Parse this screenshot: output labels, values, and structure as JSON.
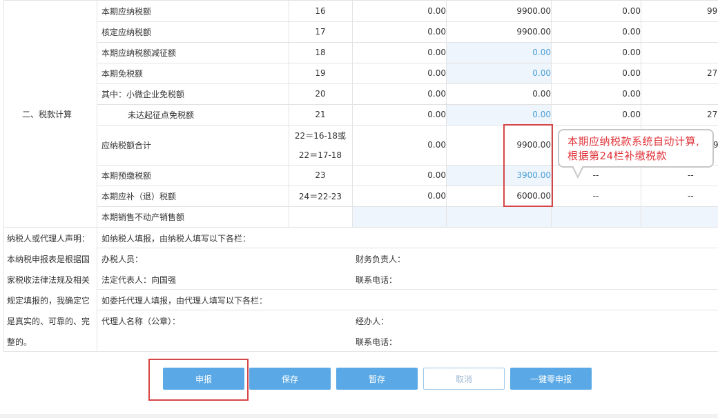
{
  "section_label": "二、税款计算",
  "rows": [
    {
      "name": "本期应纳税额",
      "line": "16",
      "c1": "0.00",
      "c2": "9900.00",
      "c3": "0.00",
      "c4": "99"
    },
    {
      "name": "核定应纳税额",
      "line": "17",
      "c1": "0.00",
      "c2": "9900.00",
      "c3": "0.00",
      "c4": ""
    },
    {
      "name": "本期应纳税额减征额",
      "line": "18",
      "c1": "0.00",
      "c2": "0.00",
      "c3": "0.00",
      "c4": ""
    },
    {
      "name": "本期免税额",
      "line": "19",
      "c1": "0.00",
      "c2": "0.00",
      "c3": "0.00",
      "c4": "27"
    },
    {
      "name": "其中：小微企业免税额",
      "line": "20",
      "c1": "0.00",
      "c2": "0.00",
      "c3": "0.00",
      "c4": ""
    },
    {
      "name": "未达起征点免税额",
      "line": "21",
      "c1": "0.00",
      "c2": "0.00",
      "c3": "0.00",
      "c4": "27"
    },
    {
      "name": "应纳税额合计",
      "line": "22＝16-18或",
      "line2": "22＝17-18",
      "c1": "0.00",
      "c2": "9900.00",
      "c3": "",
      "c4": "9"
    },
    {
      "name": "本期预缴税额",
      "line": "23",
      "c1": "0.00",
      "c2": "3900.00",
      "c3": "--",
      "c4": "--"
    },
    {
      "name": "本期应补（退）税额",
      "line": "24＝22-23",
      "c1": "0.00",
      "c2": "6000.00",
      "c3": "--",
      "c4": "--"
    },
    {
      "name": "本期销售不动产销售额",
      "line": "",
      "c1": "",
      "c2": "",
      "c3": "",
      "c4": ""
    }
  ],
  "declaration": {
    "lines": [
      "纳税人或代理人声明：",
      "本纳税申报表是根据国",
      "家税收法律法规及相关",
      "规定填报的，我确定它",
      "是真实的、可靠的、完",
      "整的。"
    ],
    "self_heading": "如纳税人填报，由纳税人填写以下各栏：",
    "tax_officer": "办税人员：",
    "finance_head": "财务负责人：",
    "legal_rep": "法定代表人：向国强",
    "phone1": "联系电话：",
    "agent_heading": "如委托代理人填报，由代理人填写以下各栏：",
    "agent_name": "代理人名称（公章）：",
    "handler": "经办人：",
    "phone2": "联系电话："
  },
  "callout": "本期应纳税款系统自动计算,根据第24栏补缴税款",
  "buttons": {
    "submit": "申报",
    "save": "保存",
    "draft": "暂存",
    "cancel": "取消",
    "zero": "一键零申报"
  },
  "colors": {
    "button_blue": "#5aa9e6",
    "highlight_red": "#d64545",
    "callout_text": "#e0343a",
    "blue_value": "#4a9fd5"
  }
}
